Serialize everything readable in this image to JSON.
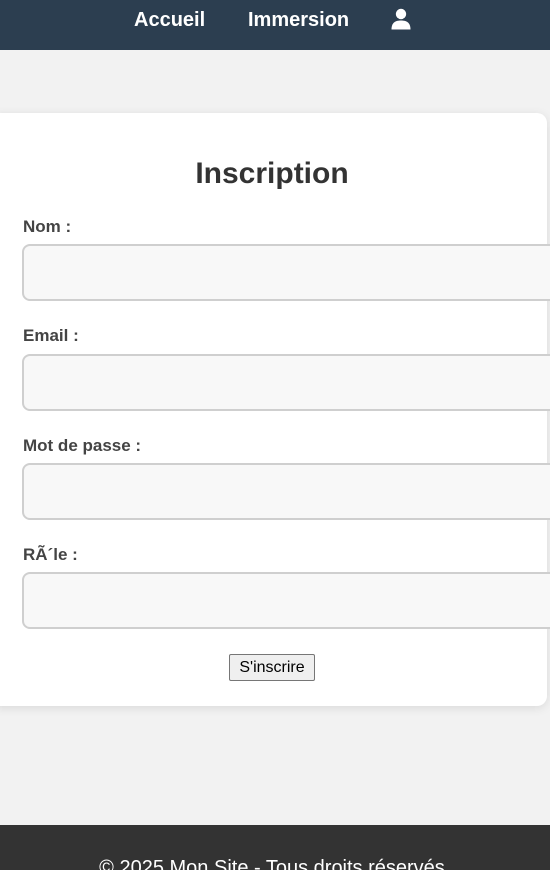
{
  "nav": {
    "links": [
      "Accueil",
      "Immersion"
    ],
    "user_icon": "user-icon",
    "background": "#2c3e50"
  },
  "form": {
    "title": "Inscription",
    "fields": [
      {
        "label": "Nom :",
        "value": ""
      },
      {
        "label": "Email :",
        "value": ""
      },
      {
        "label": "Mot de passe :",
        "value": ""
      },
      {
        "label": "RÃ´le :",
        "value": ""
      }
    ],
    "submit_label": "S'inscrire"
  },
  "footer": {
    "text": "© 2025 Mon Site - Tous droits réservés",
    "background": "#333333"
  }
}
